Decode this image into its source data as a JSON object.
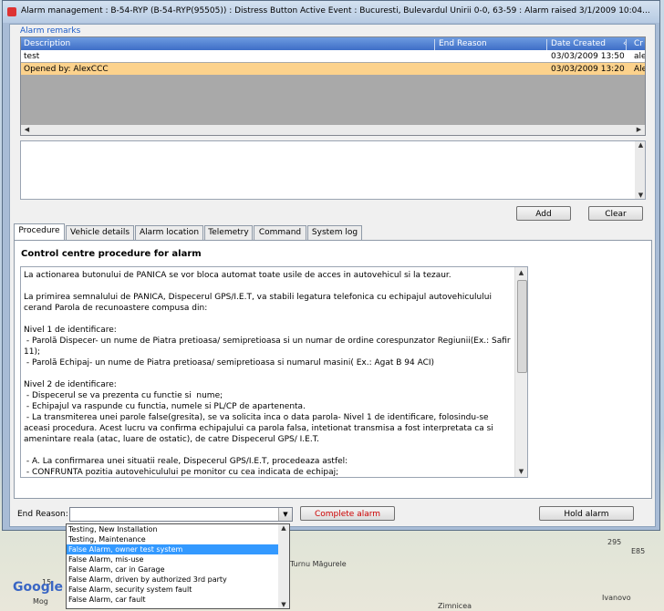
{
  "window": {
    "title": "Alarm management : B-54-RYP (B-54-RYP(95505)) : Distress Button Active Event : Bucuresti, Bulevardul Unirii 0-0, 63-59 : Alarm raised 3/1/2009 10:04..."
  },
  "remarks": {
    "label": "Alarm remarks",
    "columns": [
      "Description",
      "End Reason",
      "Date Created",
      "Cr"
    ],
    "rows": [
      {
        "description": "test",
        "end_reason": "",
        "date": "03/03/2009 13:50",
        "creator": "ale"
      },
      {
        "description": "Opened by: AlexCCC",
        "end_reason": "",
        "date": "03/03/2009 13:20",
        "creator": "Ale"
      }
    ],
    "add_label": "Add",
    "clear_label": "Clear"
  },
  "tabs": [
    {
      "label": "Procedure",
      "active": true
    },
    {
      "label": "Vehicle details",
      "active": false
    },
    {
      "label": "Alarm location",
      "active": false
    },
    {
      "label": "Telemetry",
      "active": false
    },
    {
      "label": "Command",
      "active": false
    },
    {
      "label": "System log",
      "active": false
    }
  ],
  "procedure": {
    "title": "Control centre procedure for alarm",
    "text": "La actionarea butonului de PANICA se vor bloca automat toate usile de acces in autovehicul si la tezaur.\n\nLa primirea semnalului de PANICA, Dispecerul GPS/I.E.T, va stabili legatura telefonica cu echipajul autovehiculului cerand Parola de recunoastere compusa din:\n\nNivel 1 de identificare:\n - Parolă Dispecer- un nume de Piatra pretioasa/ semipretioasa si un numar de ordine corespunzator Regiunii(Ex.: Safir 11);\n - Parolă Echipaj- un nume de Piatra pretioasa/ semipretioasa si numarul masini( Ex.: Agat B 94 ACI)\n\nNivel 2 de identificare:\n - Dispecerul se va prezenta cu functie si  nume;\n - Echipajul va raspunde cu functia, numele si PL/CP de apartenenta.\n - La transmiterea unei parole false(gresita), se va solicita inca o data parola- Nivel 1 de identificare, folosindu-se aceasi procedura. Acest lucru va confirma echipajului ca parola falsa, intetionat transmisa a fost interpretata ca si amenintare reala (atac, luare de ostatic), de catre Dispecerul GPS/ I.E.T.\n\n - A. La confirmarea unei situatii reale, Dispecerul GPS/I.E.T, procedeaza astfel:\n - CONFRUNTA pozitia autovehiculului pe monitor cu cea indicata de echipaj;"
  },
  "footer": {
    "end_reason_label": "End Reason:",
    "end_reason_value": "",
    "complete_label": "Complete alarm",
    "hold_label": "Hold alarm",
    "complete_color": "#cc0000"
  },
  "dropdown": {
    "items": [
      "Testing, New Installation",
      "Testing, Maintenance",
      "False Alarm, owner test system",
      "False Alarm, mis-use",
      "False Alarm, car in Garage",
      "False Alarm, driven by authorized 3rd party",
      "False Alarm, security system fault",
      "False Alarm, car fault"
    ],
    "selected_index": 2
  },
  "map": {
    "labels": [
      "Turnu Măgurele",
      "Zimnicea",
      "Ivanovo",
      "E85",
      "295",
      "15",
      "Mog"
    ],
    "logo": "Google"
  }
}
